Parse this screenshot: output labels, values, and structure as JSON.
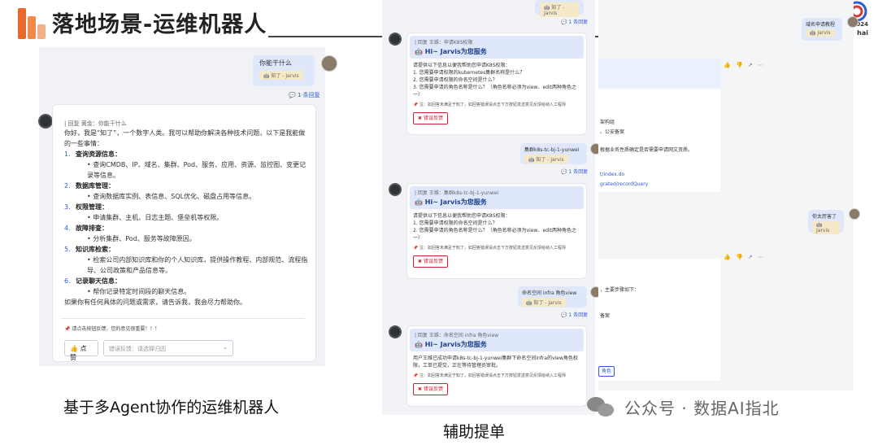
{
  "title": "落地场景-运维机器人",
  "conference": {
    "year": "2024",
    "suffix": "hai"
  },
  "left": {
    "user_question": "你能干什么",
    "tag": "知了 - Jarvis",
    "reply_count": "1 条回复",
    "reply_quote": "| 回复 黄金：你能干什么",
    "intro": "你好，我是“知了”，一个数字人类。我可以帮助你解决各种技术问题，以下是我能做的一些事情：",
    "sections": [
      {
        "num": "1.",
        "name": "查询资源信息：",
        "bullet": "查询CMDB、IP、域名、集群、Pod、服务、应用、资源、监控图、变更记录等信息。"
      },
      {
        "num": "2.",
        "name": "数据库管理：",
        "bullet": "查询数据库实例、表信息、SQL优化、磁盘占用等信息。"
      },
      {
        "num": "3.",
        "name": "权限管理：",
        "bullet": "申请集群、主机、日志主题、堡垒机等权限。"
      },
      {
        "num": "4.",
        "name": "故障排查：",
        "bullet": "分析集群、Pod、服务等故障原因。"
      },
      {
        "num": "5.",
        "name": "知识库检索：",
        "bullet": "检索公司内部知识库和你的个人知识库，提供操作教程、内部规范、流程指导、公司政策和产品信息等。"
      },
      {
        "num": "6.",
        "name": "记录聊天信息：",
        "bullet": "帮你记录特定时间段的聊天信息。"
      }
    ],
    "closing": "如果你有任何具体的问题或需求，请告诉我，我会尽力帮助你。",
    "feedback_hint": "请点击按钮反馈，您的意见很重要！！！",
    "like_button": "点赞",
    "error_select_placeholder": "错误反馈：请选择归因"
  },
  "middle": {
    "top_tag": "知了 - Jarvis",
    "top_reply": "1 条回复",
    "blocks": [
      {
        "quote": "| 回复 王维：申请K8S权限",
        "header": "Hi~ Jarvis为您服务",
        "lines": [
          "请提供以下信息以便我帮助您申请K8S权限：",
          "1. 您需要申请权限的kubernetes集群名称是什么？",
          "2. 您需要申请权限的命名空间是什么？",
          "3. 您需要申请的角色名称是什么？（角色名称必须为view、edit两种角色之一）"
        ],
        "note": "注：如回答未满足于知了，如回答错误请点击下方按钮发送意见反馈给纳入工程师",
        "button": "错误反馈"
      },
      {
        "quote": "| 回复 王维：集群k8s-tc-bj-1-yunwei",
        "header": "Hi~ Jarvis为您服务",
        "lines": [
          "请提供以下信息以便我帮助您申请K8S权限：",
          "1. 您需要申请权限的命名空间是什么？",
          "2. 您需要申请的角色名称是什么？（角色名称必须为view、edit两种角色之一）"
        ],
        "note": "注：如回答未满足于知了，如回答错误请点击下方按钮发送意见反馈给纳入工程师",
        "button": "错误反馈"
      },
      {
        "quote": "| 回复 王维：命名空间 infra 角色view",
        "header": "Hi~ Jarvis为您服务",
        "lines": [
          "用户王维已成功申请k8s-tc-bj-1-yunwei集群下命名空间infra的view角色权限，工单已提交，正在等待管理员审批。"
        ],
        "note": "注：如回答未满足于知了，如回答错误请点击下方按钮发送意见反馈给纳入工程师",
        "button": "错误反馈"
      }
    ],
    "user_messages": [
      {
        "text": "集群k8s-tc-bj-1-yunwei",
        "tag": "知了 - Jarvis",
        "reply": "1 条回复"
      },
      {
        "text": "命名空间 infra 角色view",
        "tag": "知了 - Jarvis",
        "reply": "1 条回复"
      }
    ]
  },
  "right": {
    "bubble1": {
      "text": "域名申请教程",
      "tag": "Jarvis"
    },
    "frag1": [
      "架构组",
      "、公安备案",
      "根据业务性质确定是否需要申请网文资质。",
      "t/index.do",
      "grated/recordQuery"
    ],
    "bubble2": {
      "text": "你太厉害了",
      "tag": "Jarvis"
    },
    "frag2": [
      "，主要步骤如下：",
      "备案",
      "角色"
    ]
  },
  "captions": {
    "left": "基于多Agent协作的运维机器人",
    "middle": "辅助提单"
  },
  "watermark": "公众号 · 数据AI指北"
}
